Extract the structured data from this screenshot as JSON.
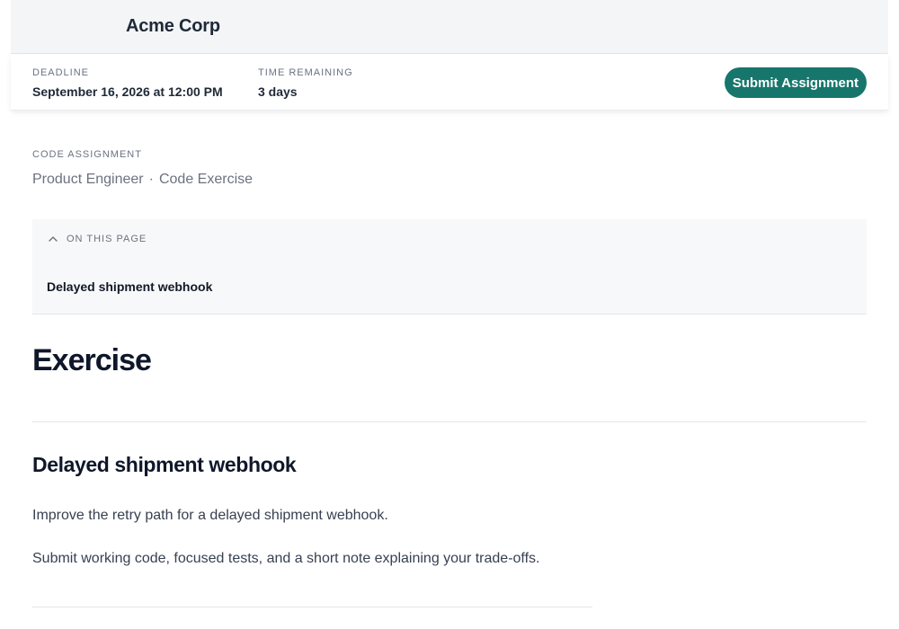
{
  "header": {
    "company_name": "Acme Corp"
  },
  "deadline_bar": {
    "deadline_label": "DEADLINE",
    "deadline_value": "September 16, 2026 at 12:00 PM",
    "remaining_label": "TIME REMAINING",
    "remaining_value": "3 days",
    "submit_label": "Submit Assignment"
  },
  "assignment": {
    "eyebrow": "CODE ASSIGNMENT",
    "role": "Product Engineer",
    "separator": "·",
    "type": "Code Exercise"
  },
  "toc": {
    "title": "ON THIS PAGE",
    "items": [
      {
        "label": "Delayed shipment webhook"
      }
    ]
  },
  "main": {
    "heading": "Exercise",
    "section_title": "Delayed shipment webhook",
    "paragraphs": [
      "Improve the retry path for a delayed shipment webhook.",
      "Submit working code, focused tests, and a short note explaining your trade-offs."
    ]
  },
  "icons": {
    "toc_toggle": "chevron-up-icon"
  },
  "colors": {
    "accent": "#17766b",
    "topbar_bg": "#f3f5f6",
    "toc_bg": "#f7f8f9"
  }
}
